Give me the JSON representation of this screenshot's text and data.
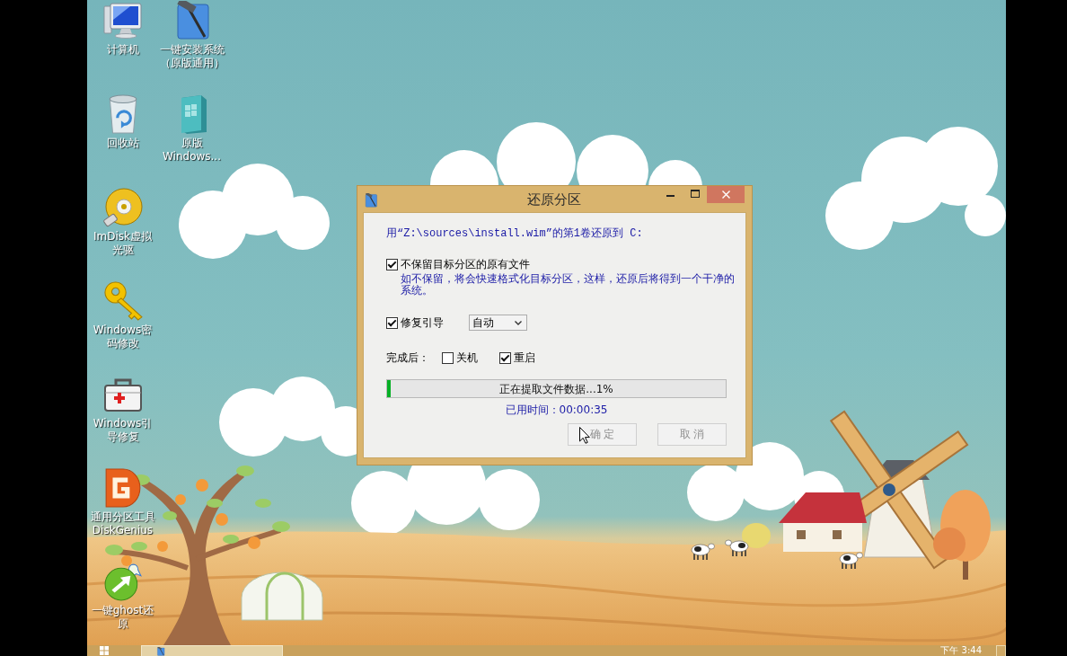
{
  "desktop": {
    "icons": [
      {
        "label": "计算机",
        "kind": "computer"
      },
      {
        "label": "回收站",
        "kind": "recycle-bin"
      },
      {
        "label": "ImDisk虚拟光驱",
        "kind": "disc"
      },
      {
        "label": "Windows密码修改",
        "kind": "key"
      },
      {
        "label": "Windows引导修复",
        "kind": "first-aid"
      },
      {
        "label": "通用分区工具DiskGenius",
        "kind": "partition-tool"
      },
      {
        "label": "一键ghost还原",
        "kind": "ghost"
      },
      {
        "label": "一键安装系统（原版通用）",
        "kind": "installer"
      },
      {
        "label": "原版Windows...",
        "kind": "windows-media"
      }
    ]
  },
  "dialog": {
    "title": "还原分区",
    "source_text": "用“Z:\\sources\\install.wim”的第1卷还原到 C:",
    "keep_files_option": {
      "label": "不保留目标分区的原有文件",
      "checked": true,
      "description": "如不保留，将会快速格式化目标分区，这样，还原后将得到一个干净的系统。"
    },
    "boot_repair_option": {
      "label": "修复引导",
      "checked": true,
      "mode": "自动"
    },
    "after_completion": {
      "label": "完成后：",
      "choices": [
        {
          "label": "关机",
          "checked": false
        },
        {
          "label": "重启",
          "checked": true
        }
      ]
    },
    "progress": {
      "level": 0.01,
      "text": "正在提取文件数据...1%"
    },
    "elapsed": "已用时间：00:00:35",
    "buttons": [
      {
        "label": "确 定",
        "disabled": true
      },
      {
        "label": "取 消",
        "disabled": true
      }
    ]
  },
  "taskbar": {
    "tasks": [
      {
        "selected": true
      }
    ],
    "clock": "下午 3:44"
  }
}
